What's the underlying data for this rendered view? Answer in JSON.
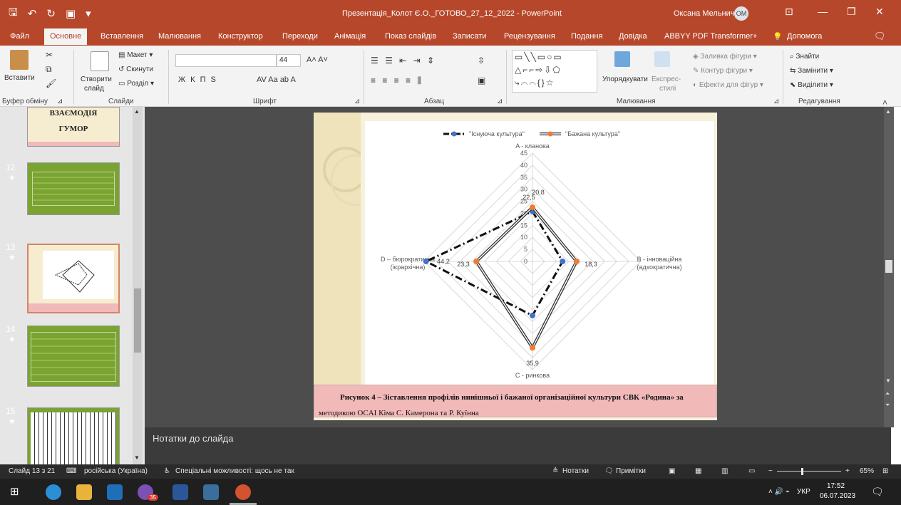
{
  "window": {
    "title": "Презентація_Колот Є.О._ГОТОВО_27_12_2022 - PowerPoint",
    "user": "Оксана Мельничук",
    "user_initials": "ОМ"
  },
  "tabs": [
    "Файл",
    "Основне",
    "Вставлення",
    "Малювання",
    "Конструктор",
    "Переходи",
    "Анімація",
    "Показ слайдів",
    "Записати",
    "Рецензування",
    "Подання",
    "Довідка",
    "ABBYY PDF Transformer+",
    "Допомога"
  ],
  "ribbon": {
    "paste": "Вставити",
    "new_slide_1": "Створити",
    "new_slide_2": "слайд",
    "layout": "Макет",
    "reset": "Скинути",
    "section": "Розділ",
    "font_size": "44",
    "arrange": "Упорядкувати",
    "quick_styles_1": "Експрес-",
    "quick_styles_2": "стилі",
    "shape_fill": "Заливка фігури",
    "shape_outline": "Контур фігури",
    "shape_effects": "Ефекти для фігур",
    "find": "Знайти",
    "replace": "Замінити",
    "select": "Виділити",
    "groups": {
      "clipboard": "Буфер обміну",
      "slides": "Слайди",
      "font": "Шрифт",
      "paragraph": "Абзац",
      "drawing": "Малювання",
      "editing": "Редагування"
    }
  },
  "thumbnails": {
    "slide11_line1": "ВЗАЄМОДІЯ",
    "slide11_line2": "ГУМОР",
    "slide_numbers": [
      "12",
      "13",
      "14",
      "15"
    ]
  },
  "chart_data": {
    "type": "radar",
    "axes": [
      "A - кланова",
      "B - інноваційна (адхократична)",
      "C - ринкова",
      "D - бюрократична (ієрархічна)"
    ],
    "rlim": [
      0,
      45
    ],
    "ticks": [
      0,
      5,
      10,
      15,
      20,
      25,
      30,
      35,
      40,
      45
    ],
    "grid": true,
    "legend": "top",
    "series": [
      {
        "name": "\"Існуюча культура\"",
        "values": [
          20.8,
          12.5,
          22.5,
          44.2
        ],
        "color": "#4472c4",
        "style": "dash-dot"
      },
      {
        "name": "\"Бажана культура\"",
        "values": [
          22.5,
          18.3,
          35.9,
          23.3
        ],
        "color": "#ed7d31",
        "style": "solid-double"
      }
    ],
    "data_labels": [
      "20,8",
      "22,5",
      "18,3",
      "35,9",
      "23,3",
      "44,2"
    ]
  },
  "caption": {
    "line1": "Рисунок 4 – Зіставлення профілів нинішньої і бажаної організаційної культури СВК «Родина» за",
    "line2": "методикою OCAI Кіма С. Камерона та Р. Куїнна"
  },
  "notes_placeholder": "Нотатки до слайда",
  "status": {
    "slide": "Слайд 13 з 21",
    "language": "російська (Україна)",
    "accessibility": "Спеціальні можливості: щось не так",
    "notes": "Нотатки",
    "comments": "Примітки",
    "zoom": "65%"
  },
  "taskbar": {
    "lang": "УКР",
    "time": "17:52",
    "date": "06.07.2023",
    "badge": "35"
  }
}
